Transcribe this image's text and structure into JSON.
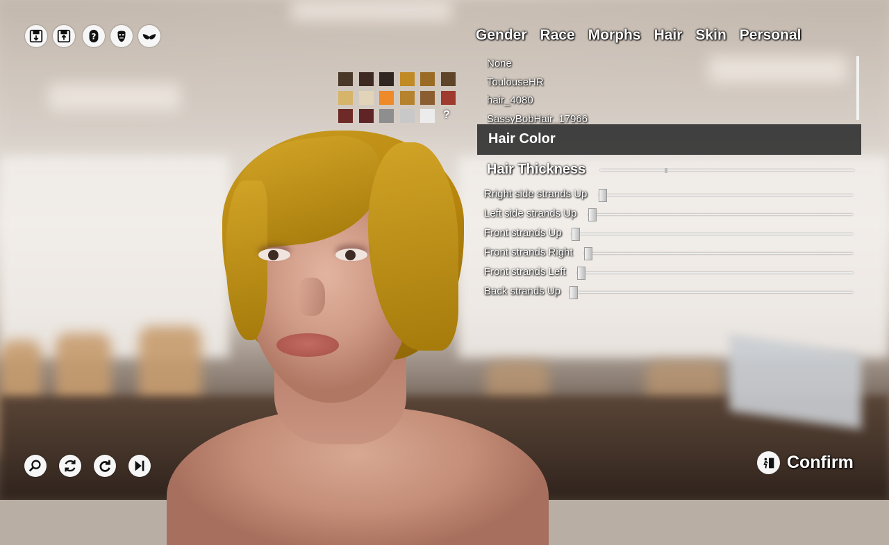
{
  "toolbar": {
    "icons": [
      "save-download-icon",
      "save-upload-icon",
      "help-icon",
      "beard-icon",
      "bra-icon"
    ]
  },
  "tabs": [
    {
      "label": "Gender"
    },
    {
      "label": "Race"
    },
    {
      "label": "Morphs"
    },
    {
      "label": "Hair"
    },
    {
      "label": "Skin"
    },
    {
      "label": "Personal"
    }
  ],
  "hair_list": {
    "items": [
      "None",
      "ToulouseHR",
      "hair_4080",
      "SassyBobHair_17966"
    ]
  },
  "swatches": {
    "colors": [
      "#4a3828",
      "#3e2a22",
      "#322622",
      "#c08a24",
      "#9a6b24",
      "#5e4428",
      "#d6b46a",
      "#e2d4b8",
      "#ee8a2a",
      "#b6822e",
      "#8a5e30",
      "#9e3a2e",
      "#6e2a26",
      "#5e2426",
      "#8e8e8e",
      "#c8c8c8",
      "#ececec"
    ],
    "random_label": "?"
  },
  "hair_color": {
    "label": "Hair Color"
  },
  "hair_thickness": {
    "label": "Hair Thickness",
    "value": 0.26
  },
  "sliders": [
    {
      "label": "Rright side strands Up",
      "value": 0.0
    },
    {
      "label": "Left side strands Up",
      "value": 0.0
    },
    {
      "label": "Front strands Up",
      "value": 0.0
    },
    {
      "label": "Front strands Right",
      "value": 0.0
    },
    {
      "label": "Front strands Left",
      "value": 0.0
    },
    {
      "label": "Back strands Up",
      "value": 0.0
    }
  ],
  "bottom_controls": {
    "icons": [
      "zoom-icon",
      "rotate-icon",
      "redo-icon",
      "skip-icon"
    ]
  },
  "confirm": {
    "label": "Confirm"
  }
}
